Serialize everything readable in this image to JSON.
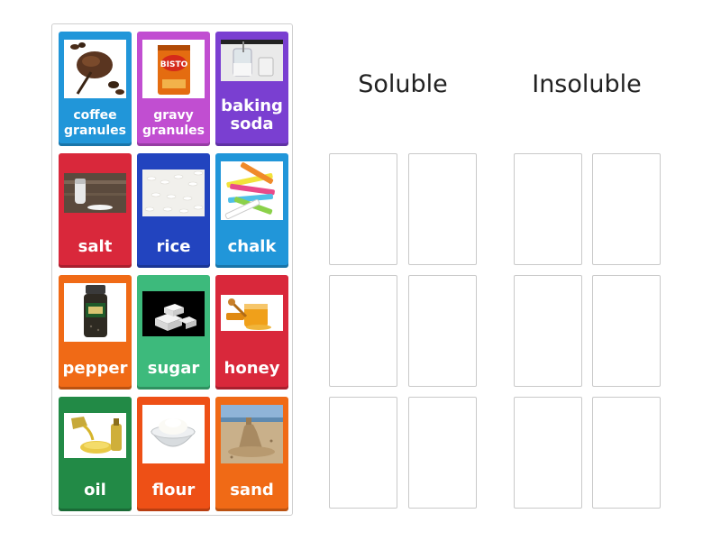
{
  "groups": {
    "soluble": "Soluble",
    "insoluble": "Insoluble"
  },
  "cards": [
    {
      "label": "coffee granules",
      "icon": "coffee-granules-image",
      "color": "#2196d9"
    },
    {
      "label": "gravy granules",
      "icon": "gravy-granules-image",
      "color": "#c14ed1"
    },
    {
      "label": "baking soda",
      "icon": "baking-soda-image",
      "color": "#7a3fd1"
    },
    {
      "label": "salt",
      "icon": "salt-image",
      "color": "#d9283b"
    },
    {
      "label": "rice",
      "icon": "rice-image",
      "color": "#2244bf"
    },
    {
      "label": "chalk",
      "icon": "chalk-image",
      "color": "#2196d9"
    },
    {
      "label": "pepper",
      "icon": "pepper-image",
      "color": "#f06a16"
    },
    {
      "label": "sugar",
      "icon": "sugar-image",
      "color": "#3dba7c"
    },
    {
      "label": "honey",
      "icon": "honey-image",
      "color": "#d9283b"
    },
    {
      "label": "oil",
      "icon": "oil-image",
      "color": "#228a46"
    },
    {
      "label": "flour",
      "icon": "flour-image",
      "color": "#ee5016"
    },
    {
      "label": "sand",
      "icon": "sand-image",
      "color": "#f06a16"
    }
  ]
}
